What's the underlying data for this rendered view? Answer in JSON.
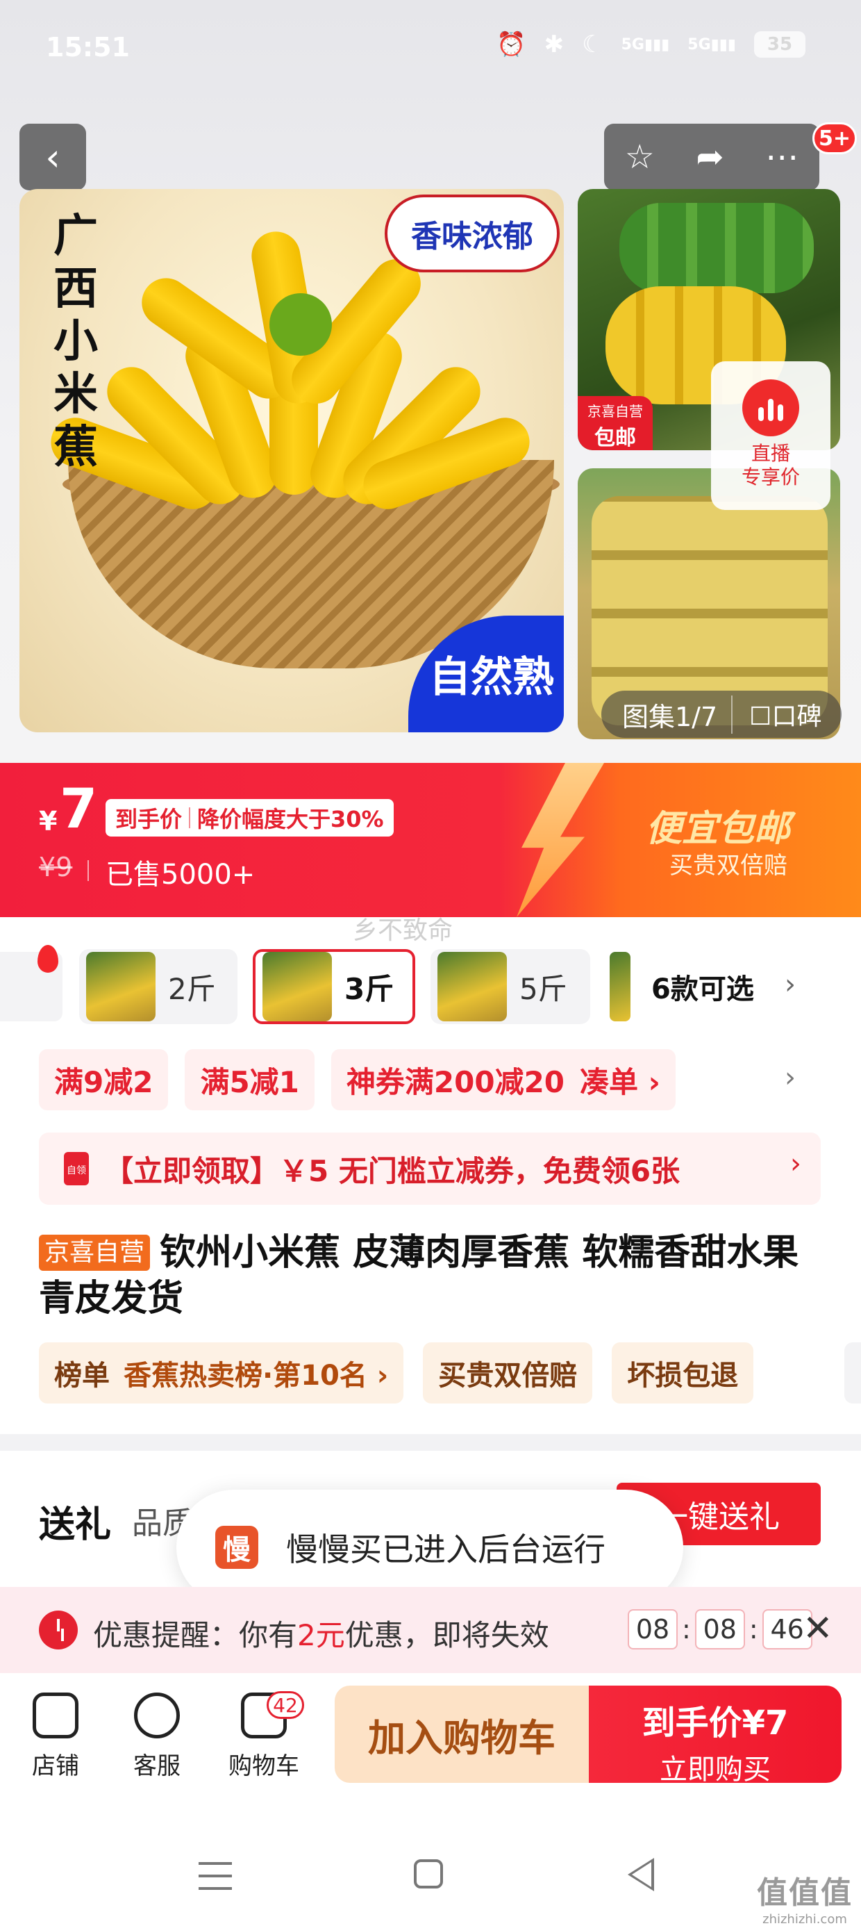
{
  "status_bar": {
    "time": "15:51",
    "network_1": "5G",
    "network_2": "5G",
    "battery": "35"
  },
  "nav": {
    "badge": "5+"
  },
  "gallery": {
    "main_title_vertical": "广西小米蕉",
    "flavor_badge": "香味浓郁",
    "ripe_badge": "自然熟",
    "thumb_tag_line1": "京喜自营",
    "thumb_tag_line2": "包邮",
    "live_label_1": "直播",
    "live_label_2": "专享价",
    "counter": "图集1/7",
    "reviews_label": "口碑"
  },
  "price": {
    "currency": "¥",
    "value": "7",
    "tag_main": "到手价",
    "tag_sub": "降价幅度大于30%",
    "original": "¥9",
    "sold": "已售5000+",
    "promo_title": "便宜包邮",
    "promo_sub": "买贵双倍赔"
  },
  "watermark": "乡不致命",
  "variants": {
    "items": [
      {
        "label": "2斤",
        "selected": false
      },
      {
        "label": "3斤",
        "selected": true
      },
      {
        "label": "5斤",
        "selected": false
      }
    ],
    "more": "6款可选"
  },
  "coupons": {
    "items": [
      "满9减2",
      "满5减1",
      "神券满200减20"
    ],
    "coudan": "凑单 ›"
  },
  "claim": {
    "icon_text": "自领",
    "text": "【立即领取】￥5 无门槛立减券，免费领6张"
  },
  "product": {
    "self_tag": "京喜自营",
    "title": "钦州小米蕉 皮薄肉厚香蕉 软糯香甜水果 青皮发货"
  },
  "features": {
    "rank_label": "榜单",
    "rank_value": "香蕉热卖榜·第10名 ›",
    "tag_2": "买贵双倍赔",
    "tag_3": "坏损包退"
  },
  "gift": {
    "label": "送礼",
    "sub": "品质",
    "button": "一键送礼"
  },
  "toast": {
    "icon_text": "慢",
    "text": "慢慢买已进入后台运行"
  },
  "reminder": {
    "prefix": "优惠提醒：你有",
    "amount": "2元",
    "suffix": "优惠，即将失效",
    "hh": "08",
    "mm": "08",
    "ss": "46"
  },
  "bottom_bar": {
    "shop": "店铺",
    "service": "客服",
    "cart": "购物车",
    "cart_count": "42",
    "add_to_cart": "加入购物车",
    "buy_line1": "到手价¥7",
    "buy_line2": "立即购买"
  },
  "site_mark": {
    "name": "值值值",
    "domain": "zhizhizhi.com"
  },
  "colors": {
    "brand_red": "#f5283b",
    "promo_orange": "#ff8a1a",
    "self_tag": "#f26b1d"
  },
  "icons": [
    "back-arrow-icon",
    "star-icon",
    "share-icon",
    "more-icon",
    "live-icon",
    "shop-icon",
    "service-icon",
    "cart-icon",
    "alarm-clock-icon",
    "clock-icon",
    "bluetooth-icon",
    "moon-icon",
    "close-icon"
  ]
}
